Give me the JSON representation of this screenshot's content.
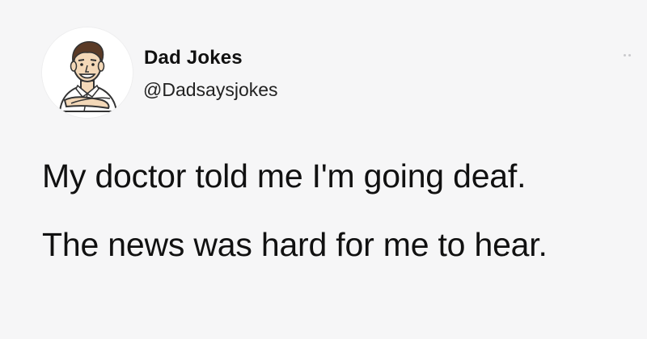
{
  "tweet": {
    "author": {
      "display_name": "Dad Jokes",
      "handle": "@Dadsaysjokes",
      "avatar_icon": "cartoon-dad-avatar"
    },
    "more_icon": "more-options-dots-icon",
    "text_lines": [
      "My doctor told me I'm going deaf.",
      "The news was hard for me to hear."
    ]
  },
  "colors": {
    "background": "#f6f6f7",
    "text": "#111111",
    "more_dots": "#c9c9cc"
  }
}
